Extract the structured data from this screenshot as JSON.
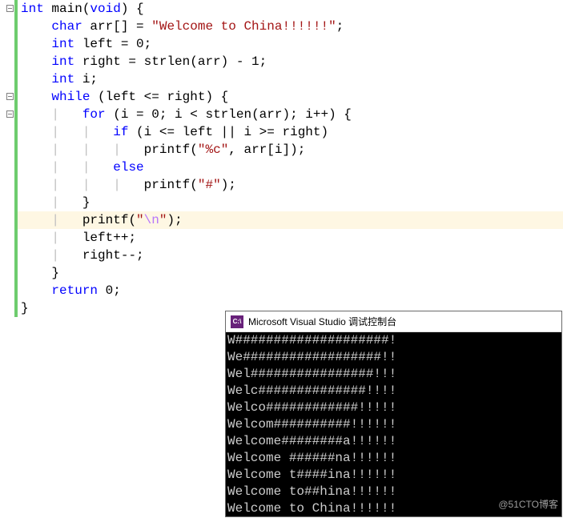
{
  "editor": {
    "lines": [
      {
        "indent": 0,
        "fold": true,
        "seg": [
          {
            "c": "kw",
            "t": "int"
          },
          {
            "t": " main("
          },
          {
            "c": "kw",
            "t": "void"
          },
          {
            "t": ") {"
          }
        ]
      },
      {
        "indent": 1,
        "seg": [
          {
            "c": "kw",
            "t": "char"
          },
          {
            "t": " arr[] = "
          },
          {
            "c": "str",
            "t": "\"Welcome to China!!!!!!\""
          },
          {
            "t": ";"
          }
        ]
      },
      {
        "indent": 1,
        "seg": [
          {
            "c": "kw",
            "t": "int"
          },
          {
            "t": " left = 0;"
          }
        ]
      },
      {
        "indent": 1,
        "seg": [
          {
            "c": "kw",
            "t": "int"
          },
          {
            "t": " right = strlen(arr) - 1;"
          }
        ]
      },
      {
        "indent": 1,
        "seg": [
          {
            "c": "kw",
            "t": "int"
          },
          {
            "t": " i;"
          }
        ]
      },
      {
        "indent": 1,
        "fold": true,
        "seg": [
          {
            "c": "kw",
            "t": "while"
          },
          {
            "t": " (left <= right) {"
          }
        ]
      },
      {
        "indent": 2,
        "fold": true,
        "seg": [
          {
            "c": "kw",
            "t": "for"
          },
          {
            "t": " (i = 0; i < strlen(arr); i++) {"
          }
        ]
      },
      {
        "indent": 3,
        "seg": [
          {
            "c": "kw",
            "t": "if"
          },
          {
            "t": " (i <= left || i >= right)"
          }
        ]
      },
      {
        "indent": 4,
        "seg": [
          {
            "t": "printf("
          },
          {
            "c": "str",
            "t": "\"%c\""
          },
          {
            "t": ", arr[i]);"
          }
        ]
      },
      {
        "indent": 3,
        "seg": [
          {
            "c": "kw",
            "t": "else"
          }
        ]
      },
      {
        "indent": 4,
        "seg": [
          {
            "t": "printf("
          },
          {
            "c": "str",
            "t": "\"#\""
          },
          {
            "t": ");"
          }
        ]
      },
      {
        "indent": 2,
        "seg": [
          {
            "t": "}"
          }
        ]
      },
      {
        "indent": 2,
        "hl": true,
        "seg": [
          {
            "t": "printf("
          },
          {
            "c": "str",
            "t": "\""
          },
          {
            "c": "esc",
            "t": "\\n"
          },
          {
            "c": "str",
            "t": "\""
          },
          {
            "t": ");"
          }
        ]
      },
      {
        "indent": 2,
        "seg": [
          {
            "t": "left++;"
          }
        ]
      },
      {
        "indent": 2,
        "seg": [
          {
            "t": "right--;"
          }
        ]
      },
      {
        "indent": 1,
        "seg": [
          {
            "t": "}"
          }
        ]
      },
      {
        "indent": 1,
        "seg": [
          {
            "c": "kw",
            "t": "return"
          },
          {
            "t": " 0;"
          }
        ]
      },
      {
        "indent": 0,
        "seg": [
          {
            "t": "}"
          }
        ]
      }
    ],
    "indent_unit": "    ",
    "guide_char": "|   "
  },
  "console": {
    "title": "Microsoft Visual Studio 调试控制台",
    "icon_text": "C:\\",
    "lines": [
      "W####################!",
      "We##################!!",
      "Wel################!!!",
      "Welc##############!!!!",
      "Welco############!!!!!",
      "Welcom##########!!!!!!",
      "Welcome########a!!!!!!",
      "Welcome ######na!!!!!!",
      "Welcome t####ina!!!!!!",
      "Welcome to##hina!!!!!!",
      "Welcome to China!!!!!!"
    ]
  },
  "watermark": "@51CTO博客"
}
